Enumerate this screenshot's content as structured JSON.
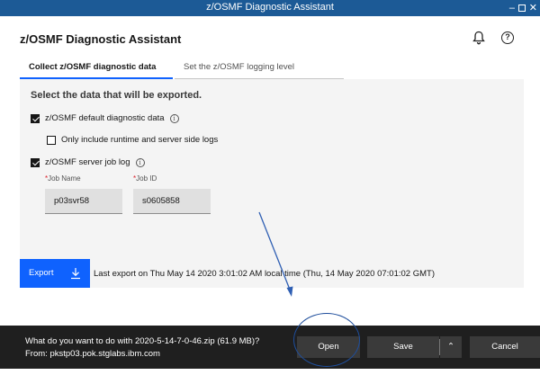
{
  "window": {
    "title": "z/OSMF Diagnostic Assistant",
    "minimize": "–",
    "close": "✕"
  },
  "header": {
    "title": "z/OSMF Diagnostic Assistant",
    "notification_icon": "bell-icon",
    "help_icon": "help-icon",
    "help_glyph": "?"
  },
  "tabs": [
    {
      "label": "Collect z/OSMF diagnostic data",
      "active": true
    },
    {
      "label": "Set the z/OSMF logging level",
      "active": false
    }
  ],
  "panel": {
    "title": "Select the data that will be exported.",
    "options": [
      {
        "label": "z/OSMF default diagnostic data",
        "checked": true,
        "info": "i"
      },
      {
        "label": "Only include runtime and server side logs",
        "checked": false
      },
      {
        "label": "z/OSMF server job log",
        "checked": true,
        "info": "i"
      }
    ],
    "fields": {
      "job_name": {
        "required_mark": "*",
        "label": "Job Name",
        "value": "p03svr58"
      },
      "job_id": {
        "required_mark": "*",
        "label": "Job ID",
        "value": "s0605858"
      }
    }
  },
  "export": {
    "label": "Export",
    "icon": "download-icon",
    "last_export": "Last export on Thu May 14 2020 3:01:02 AM local time (Thu, 14 May 2020 07:01:02 GMT)"
  },
  "download_bar": {
    "question": "What do you want to do with 2020-5-14-7-0-46.zip (61.9 MB)?",
    "from": "From: pkstp03.pok.stglabs.ibm.com",
    "open": "Open",
    "save": "Save",
    "caret": "⌃",
    "cancel": "Cancel"
  },
  "colors": {
    "titlebar": "#1c5a96",
    "accent": "#0f62fe",
    "download_bar": "#1f1f1f",
    "annotation": "#1f4e9c"
  }
}
